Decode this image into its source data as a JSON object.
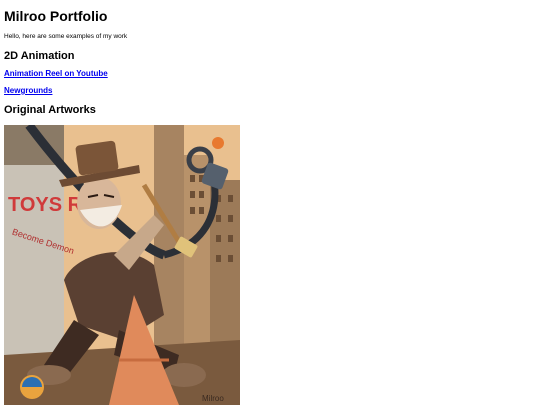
{
  "page": {
    "title": "Milroo Portfolio",
    "intro": "Hello, here are some examples of my work",
    "sections": {
      "animation": {
        "heading": "2D Animation",
        "links": [
          {
            "label": "Animation Reel on Youtube"
          },
          {
            "label": "Newgrounds"
          }
        ]
      },
      "artworks": {
        "heading": "Original Artworks",
        "image": {
          "sign_text": "TOYS R",
          "banner_text": "Become Demon",
          "signature": "Milroo"
        }
      }
    }
  },
  "colors": {
    "link": "#0000ee",
    "text": "#000000",
    "background": "#ffffff"
  }
}
